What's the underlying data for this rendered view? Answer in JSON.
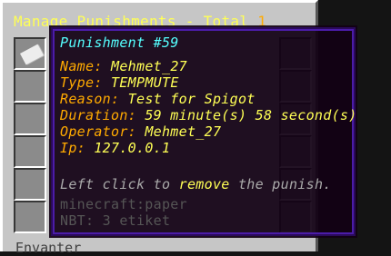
{
  "window": {
    "title_prefix": "Manage Punishments - Total ",
    "total": "1",
    "inventory_label": "Envanter"
  },
  "tooltip": {
    "heading": "Punishment #59",
    "fields": [
      {
        "label": "Name: ",
        "value": "Mehmet_27"
      },
      {
        "label": "Type: ",
        "value": "TEMPMUTE"
      },
      {
        "label": "Reason: ",
        "value": "Test for Spigot"
      },
      {
        "label": "Duration: ",
        "value": "59 minute(s) 58 second(s)"
      },
      {
        "label": "Operator: ",
        "value": "Mehmet_27"
      },
      {
        "label": "Ip: ",
        "value": "127.0.0.1"
      }
    ],
    "hint_prefix": "Left click to ",
    "hint_action": "remove",
    "hint_suffix": " the punish.",
    "item_id": "minecraft:paper",
    "nbt": "NBT: 3 etiket"
  },
  "slots": {
    "first_item_icon": "paper-icon"
  },
  "colors": {
    "panel": "#c6c6c6",
    "slot": "#8b8b8b",
    "tooltip_bg": "#120114",
    "tooltip_border": "#4b1ca8",
    "aqua": "#55ffff",
    "gold": "#ffaa00",
    "yellow": "#ffff55",
    "gray": "#aaaaaa"
  }
}
